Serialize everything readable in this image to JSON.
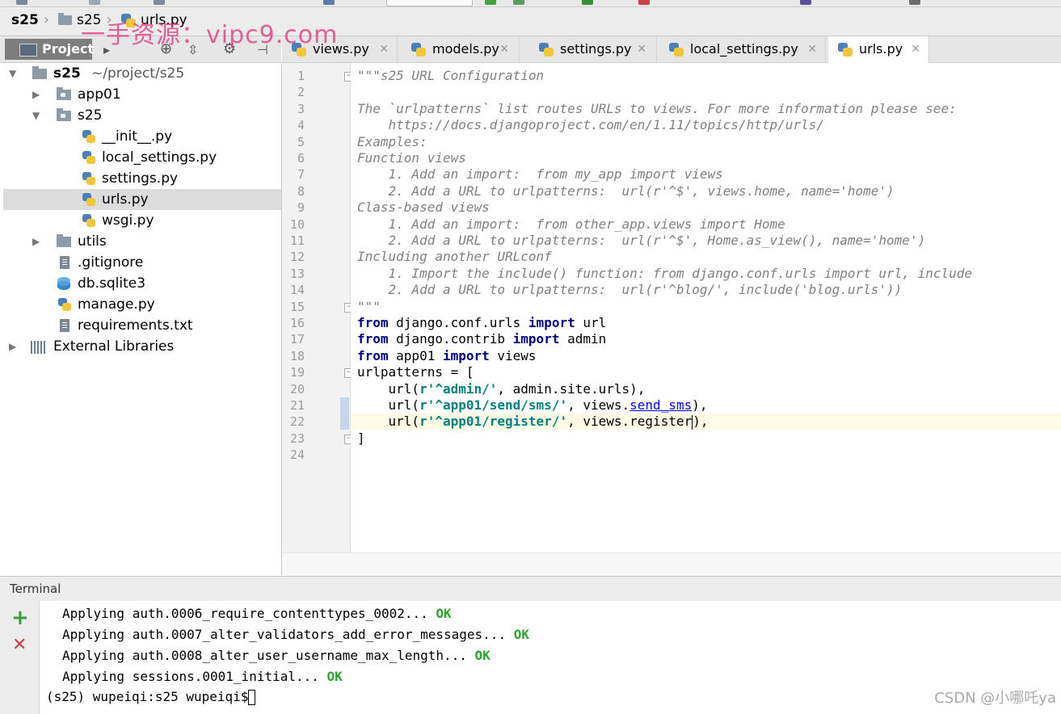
{
  "watermark": "一手资源：vipc9.com",
  "breadcrumb": [
    "s25",
    "s25",
    "urls.py"
  ],
  "project_panel": {
    "tab_label": "Project",
    "icons": [
      "target-icon",
      "split-icon",
      "gear-icon",
      "collapse-icon"
    ]
  },
  "editor_tabs": [
    {
      "label": "views.py",
      "active": false
    },
    {
      "label": "models.py",
      "active": false
    },
    {
      "label": "settings.py",
      "active": false
    },
    {
      "label": "local_settings.py",
      "active": false
    },
    {
      "label": "urls.py",
      "active": true
    }
  ],
  "tree": {
    "root_label": "s25",
    "root_path": "~/project/s25",
    "items": [
      {
        "label": "app01",
        "type": "folder",
        "state": "collapsed"
      },
      {
        "label": "s25",
        "type": "folder",
        "state": "expanded"
      },
      {
        "label": "__init__.py",
        "type": "python"
      },
      {
        "label": "local_settings.py",
        "type": "python"
      },
      {
        "label": "settings.py",
        "type": "python"
      },
      {
        "label": "urls.py",
        "type": "python",
        "selected": true
      },
      {
        "label": "wsgi.py",
        "type": "python"
      },
      {
        "label": "utils",
        "type": "folder",
        "state": "collapsed"
      },
      {
        "label": ".gitignore",
        "type": "text"
      },
      {
        "label": "db.sqlite3",
        "type": "database"
      },
      {
        "label": "manage.py",
        "type": "python"
      },
      {
        "label": "requirements.txt",
        "type": "text"
      },
      {
        "label": "External Libraries",
        "type": "library",
        "state": "collapsed"
      }
    ]
  },
  "editor": {
    "current_line": 22,
    "lines": [
      "\"\"\"s25 URL Configuration",
      "",
      "The `urlpatterns` list routes URLs to views. For more information please see:",
      "    https://docs.djangoproject.com/en/1.11/topics/http/urls/",
      "Examples:",
      "Function views",
      "    1. Add an import:  from my_app import views",
      "    2. Add a URL to urlpatterns:  url(r'^$', views.home, name='home')",
      "Class-based views",
      "    1. Add an import:  from other_app.views import Home",
      "    2. Add a URL to urlpatterns:  url(r'^$', Home.as_view(), name='home')",
      "Including another URLconf",
      "    1. Import the include() function: from django.conf.urls import url, include",
      "    2. Add a URL to urlpatterns:  url(r'^blog/', include('blog.urls'))",
      "\"\"\"",
      "from django.conf.urls import url",
      "from django.contrib import admin",
      "from app01 import views",
      "urlpatterns = [",
      "    url(r'^admin/', admin.site.urls),",
      "    url(r'^app01/send/sms/', views.send_sms),",
      "    url(r'^app01/register/', views.register),",
      "]",
      ""
    ]
  },
  "terminal": {
    "title": "Terminal",
    "lines": [
      {
        "text": "Applying auth.0006_require_contenttypes_0002...",
        "status": "OK"
      },
      {
        "text": "Applying auth.0007_alter_validators_add_error_messages...",
        "status": "OK"
      },
      {
        "text": "Applying auth.0008_alter_user_username_max_length...",
        "status": "OK"
      },
      {
        "text": "Applying sessions.0001_initial...",
        "status": "OK"
      }
    ],
    "prompt": "(s25) wupeiqi:s25 wupeiqi$",
    "side_icons": [
      "add-icon",
      "close-icon"
    ]
  },
  "footer_watermark": "CSDN @小哪吒ya",
  "colors": {
    "keyword": "#000080",
    "string": "#008080",
    "docstring": "#808080",
    "ok": "#2ea52e",
    "current_line": "#fffae3"
  }
}
